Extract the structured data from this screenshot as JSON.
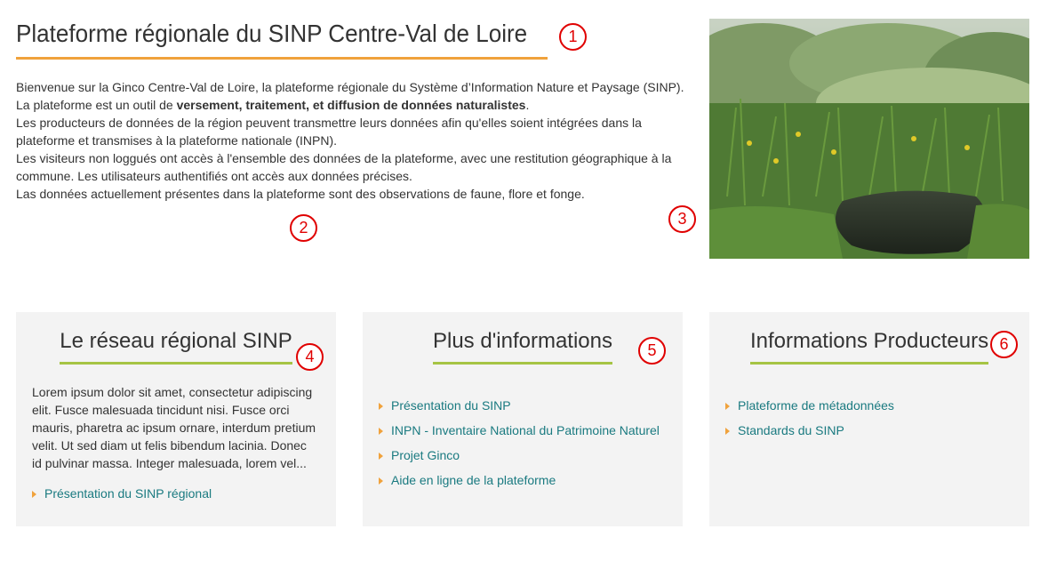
{
  "header": {
    "title": "Plateforme régionale du SINP Centre-Val de Loire"
  },
  "intro": {
    "p1_start": "Bienvenue sur la Ginco Centre-Val de Loire, la plateforme régionale du Système d’Information Nature et Paysage (SINP).  La plateforme est un outil de ",
    "p1_bold": "versement, traitement, et diffusion de données naturalistes",
    "p1_end": ".",
    "p2": "Les producteurs de données de la région peuvent transmettre leurs données afin qu'elles soient intégrées dans la plateforme et transmises à la plateforme nationale (INPN).",
    "p3": "Les visiteurs non loggués ont accès à l'ensemble des données de la plateforme, avec une restitution géographique à la commune. Les utilisateurs authentifiés ont accès aux données précises.",
    "p4": "Las données actuellement présentes dans la plateforme sont des observations de faune, flore et fonge."
  },
  "markers": [
    "1",
    "2",
    "3",
    "4",
    "5",
    "6"
  ],
  "cards": {
    "reseau": {
      "title": "Le réseau régional SINP",
      "body": "Lorem ipsum dolor sit amet, consectetur adipiscing elit. Fusce malesuada tincidunt nisi. Fusce orci mauris, pharetra ac ipsum ornare, interdum pretium velit. Ut sed diam ut felis bibendum lacinia. Donec id pulvinar massa. Integer malesuada, lorem vel...",
      "links": [
        "Présentation du SINP régional"
      ]
    },
    "infos": {
      "title": "Plus d'informations",
      "links": [
        "Présentation du SINP",
        "INPN - Inventaire National du Patrimoine Naturel",
        "Projet Ginco",
        "Aide en ligne de la plateforme"
      ]
    },
    "producteurs": {
      "title": "Informations Producteurs",
      "links": [
        "Plateforme de métadonnées",
        "Standards du SINP"
      ]
    }
  },
  "colors": {
    "title_underline": "#f0a23c",
    "card_underline": "#a6c444",
    "link": "#1a7a80",
    "bullet": "#f0a23c",
    "card_bg": "#f3f3f3",
    "marker": "#e00000"
  }
}
